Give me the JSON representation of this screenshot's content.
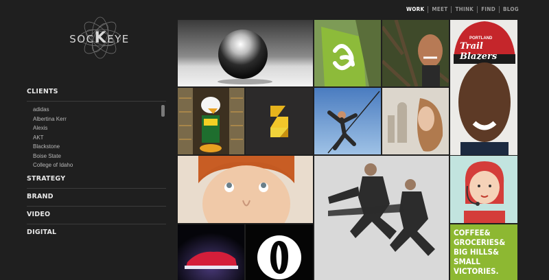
{
  "topnav": {
    "items": [
      "WORK",
      "MEET",
      "THINK",
      "FIND",
      "BLOG"
    ],
    "active": "WORK"
  },
  "logo": {
    "text_pre": "SOC",
    "text_k": "K",
    "text_post": "EYE"
  },
  "sidebar": {
    "clients_label": "CLIENTS",
    "clients": [
      "adidas",
      "Albertina Kerr",
      "Alexis",
      "AKT",
      "Blackstone",
      "Boise State",
      "College of Idaho"
    ],
    "sections": [
      "STRATEGY",
      "BRAND",
      "VIDEO",
      "DIGITAL"
    ]
  },
  "tiles": {
    "coffee_text": [
      "COFFEE&",
      "GROCERIES&",
      "BIG HILLS&",
      "SMALL VICTORIES."
    ],
    "blazers_text": "Trail Blazers",
    "portland_text": "PORTLAND"
  },
  "colors": {
    "background": "#1f1f1f",
    "green_flag": "#8dbb3a",
    "coffee_bg": "#8db832",
    "s_logo_bg": "#2c2a2a"
  }
}
